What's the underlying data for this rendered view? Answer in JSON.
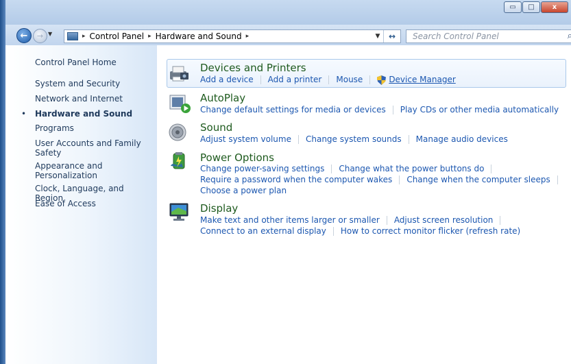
{
  "window": {
    "minimize_glyph": "▭",
    "maximize_glyph": "□",
    "close_glyph": "x"
  },
  "nav": {
    "back_glyph": "←",
    "forward_glyph": "→",
    "dropdown_glyph": "▼",
    "breadcrumb": [
      "Control Panel",
      "Hardware and Sound"
    ],
    "crumb_separator": "▸",
    "search_placeholder": "Search Control Panel",
    "search_icon": "magnifier-icon",
    "refresh_glyph": "↔"
  },
  "sidebar": {
    "items": [
      {
        "label": "Control Panel Home"
      },
      {
        "label": "System and Security"
      },
      {
        "label": "Network and Internet"
      },
      {
        "label": "Hardware and Sound",
        "active": true
      },
      {
        "label": "Programs"
      },
      {
        "label": "User Accounts and Family Safety"
      },
      {
        "label": "Appearance and Personalization"
      },
      {
        "label": "Clock, Language, and Region"
      },
      {
        "label": "Ease of Access"
      }
    ],
    "bullet": "•"
  },
  "categories": [
    {
      "title": "Devices and Printers",
      "icon": "printer-icon",
      "links": [
        [
          "Add a device",
          "Add a printer",
          "Mouse",
          "Device Manager"
        ]
      ]
    },
    {
      "title": "AutoPlay",
      "icon": "autoplay-icon",
      "links": [
        [
          "Change default settings for media or devices",
          "Play CDs or other media automatically"
        ]
      ]
    },
    {
      "title": "Sound",
      "icon": "speaker-icon",
      "links": [
        [
          "Adjust system volume",
          "Change system sounds",
          "Manage audio devices"
        ]
      ]
    },
    {
      "title": "Power Options",
      "icon": "power-icon",
      "links": [
        [
          "Change power-saving settings",
          "Change what the power buttons do"
        ],
        [
          "Require a password when the computer wakes",
          "Change when the computer sleeps"
        ],
        [
          "Choose a power plan"
        ]
      ]
    },
    {
      "title": "Display",
      "icon": "monitor-icon",
      "links": [
        [
          "Make text and other items larger or smaller",
          "Adjust screen resolution"
        ],
        [
          "Connect to an external display",
          "How to correct monitor flicker (refresh rate)"
        ]
      ]
    }
  ],
  "colors": {
    "link": "#1c57b0",
    "category_title": "#1e5a1e",
    "sidebar_text": "#1e395b"
  }
}
